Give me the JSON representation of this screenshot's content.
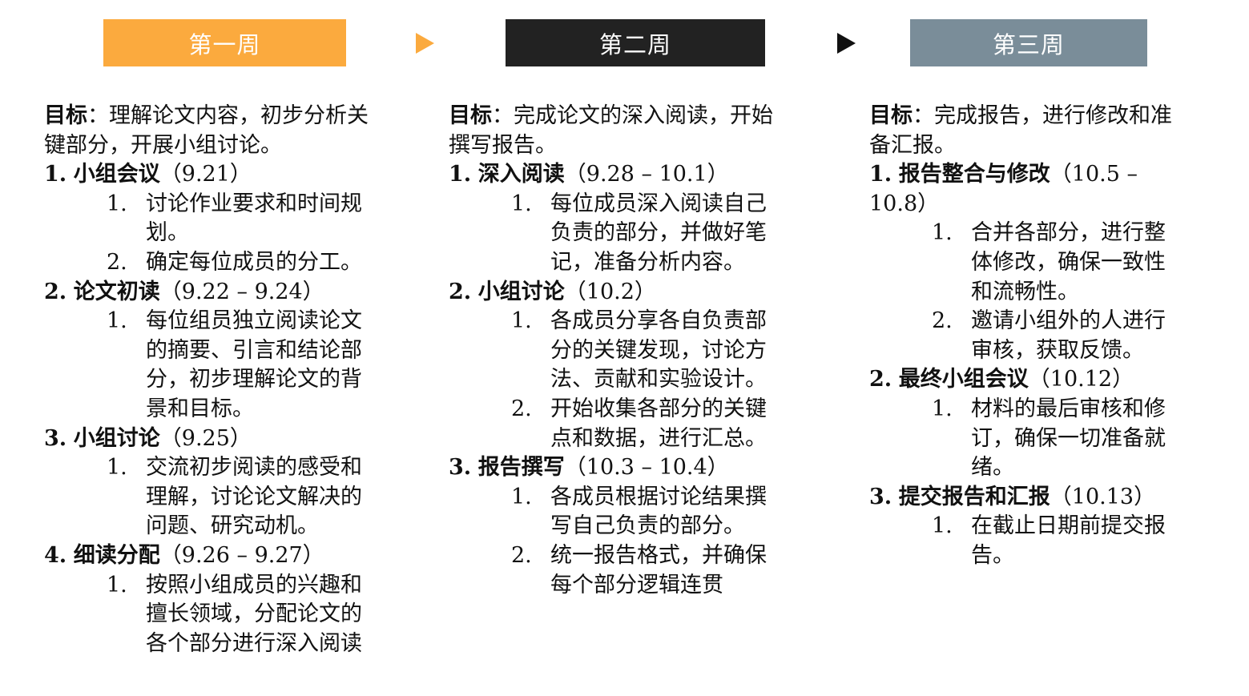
{
  "weeks": [
    {
      "header": "第一周",
      "color": "#FBAA3E",
      "goal_label": "目标",
      "goal_text": "：理解论文内容，初步分析关键部分，开展小组讨论。",
      "sections": [
        {
          "num": "1.",
          "name": "小组会议",
          "date": "（9.21）",
          "items": [
            {
              "num": "1.",
              "text": "讨论作业要求和时间规划。"
            },
            {
              "num": "2.",
              "text": "确定每位成员的分工。"
            }
          ]
        },
        {
          "num": "2.",
          "name": "论文初读",
          "date": "（9.22 – 9.24）",
          "items": [
            {
              "num": "1.",
              "text": "每位组员独立阅读论文的摘要、引言和结论部分，初步理解论文的背景和目标。"
            }
          ]
        },
        {
          "num": "3.",
          "name": "小组讨论",
          "date": "（9.25）",
          "items": [
            {
              "num": "1.",
              "text": "交流初步阅读的感受和理解，讨论论文解决的问题、研究动机。"
            }
          ]
        },
        {
          "num": "4.",
          "name": "细读分配",
          "date": "（9.26 – 9.27）",
          "items": [
            {
              "num": "1.",
              "text": "按照小组成员的兴趣和擅长领域，分配论文的各个部分进行深入阅读"
            }
          ]
        }
      ]
    },
    {
      "header": "第二周",
      "color": "#222222",
      "goal_label": "目标",
      "goal_text": "：完成论文的深入阅读，开始撰写报告。",
      "sections": [
        {
          "num": "1.",
          "name": "深入阅读",
          "date": "（9.28 – 10.1）",
          "items": [
            {
              "num": "1.",
              "text": "每位成员深入阅读自己负责的部分，并做好笔记，准备分析内容。"
            }
          ]
        },
        {
          "num": "2.",
          "name": "小组讨论",
          "date": "（10.2）",
          "items": [
            {
              "num": "1.",
              "text": "各成员分享各自负责部分的关键发现，讨论方法、贡献和实验设计。"
            },
            {
              "num": "2.",
              "text": "开始收集各部分的关键点和数据，进行汇总。"
            }
          ]
        },
        {
          "num": "3.",
          "name": "报告撰写",
          "date": "（10.3 – 10.4）",
          "items": [
            {
              "num": "1.",
              "text": "各成员根据讨论结果撰写自己负责的部分。"
            },
            {
              "num": "2.",
              "text": "统一报告格式，并确保每个部分逻辑连贯"
            }
          ]
        }
      ]
    },
    {
      "header": "第三周",
      "color": "#7A8D99",
      "goal_label": "目标",
      "goal_text": "：完成报告，进行修改和准备汇报。",
      "sections": [
        {
          "num": "1.",
          "name": "报告整合与修改",
          "date": "（10.5 – 10.8）",
          "items": [
            {
              "num": "1.",
              "text": "合并各部分，进行整体修改，确保一致性和流畅性。"
            },
            {
              "num": "2.",
              "text": "邀请小组外的人进行审核，获取反馈。"
            }
          ]
        },
        {
          "num": "2.",
          "name": "最终小组会议",
          "date": "（10.12）",
          "items": [
            {
              "num": "1.",
              "text": "材料的最后审核和修订，确保一切准备就绪。"
            }
          ]
        },
        {
          "num": "3.",
          "name": "提交报告和汇报",
          "date": "（10.13）",
          "items": [
            {
              "num": "1.",
              "text": "在截止日期前提交报告。"
            }
          ]
        }
      ]
    }
  ],
  "arrows": [
    {
      "icon": "arrow-right-icon",
      "color": "#FBAA3E"
    },
    {
      "icon": "arrow-right-icon",
      "color": "#111111"
    }
  ]
}
